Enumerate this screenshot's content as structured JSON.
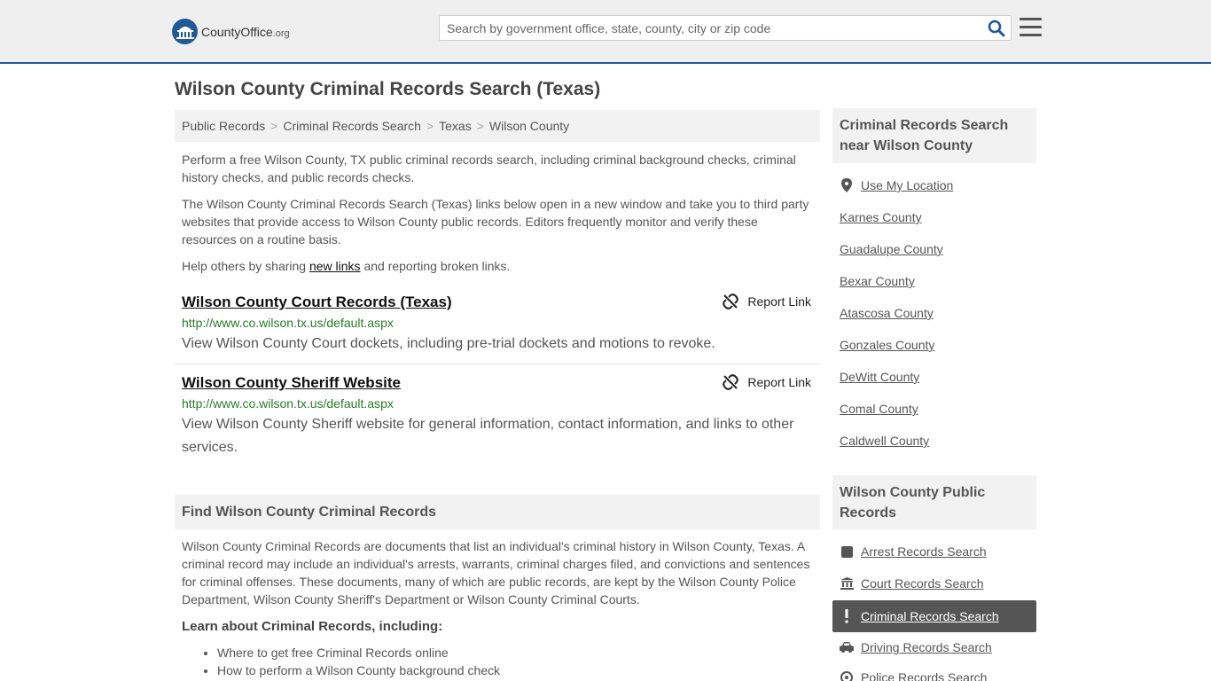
{
  "header": {
    "logo_name": "CountyOffice",
    "logo_tld": ".org",
    "search_placeholder": "Search by government office, state, county, city or zip code"
  },
  "page_title": "Wilson County Criminal Records Search (Texas)",
  "breadcrumb": [
    "Public Records",
    "Criminal Records Search",
    "Texas",
    "Wilson County"
  ],
  "intro": {
    "p1": "Perform a free Wilson County, TX public criminal records search, including criminal background checks, criminal history checks, and public records checks.",
    "p2": "The Wilson County Criminal Records Search (Texas) links below open in a new window and take you to third party websites that provide access to Wilson County public records. Editors frequently monitor and verify these resources on a routine basis.",
    "p3_before": "Help others by sharing ",
    "p3_link": "new links",
    "p3_after": " and reporting broken links."
  },
  "results": [
    {
      "title": "Wilson County Court Records (Texas)",
      "report": "Report Link",
      "url": "http://www.co.wilson.tx.us/default.aspx",
      "desc": "View Wilson County Court dockets, including pre-trial dockets and motions to revoke."
    },
    {
      "title": "Wilson County Sheriff Website",
      "report": "Report Link",
      "url": "http://www.co.wilson.tx.us/default.aspx",
      "desc": "View Wilson County Sheriff website for general information, contact information, and links to other services."
    }
  ],
  "find_section": {
    "heading": "Find Wilson County Criminal Records",
    "body": "Wilson County Criminal Records are documents that list an individual's criminal history in Wilson County, Texas. A criminal record may include an individual's arrests, warrants, criminal charges filed, and convictions and sentences for criminal offenses. These documents, many of which are public records, are kept by the Wilson County Police Department, Wilson County Sheriff's Department or Wilson County Criminal Courts.",
    "learn_heading": "Learn about Criminal Records, including:",
    "learn_items": [
      "Where to get free Criminal Records online",
      "How to perform a Wilson County background check"
    ]
  },
  "sidebar": {
    "nearby_heading": "Criminal Records Search near Wilson County",
    "use_location": "Use My Location",
    "nearby": [
      "Karnes County",
      "Guadalupe County",
      "Bexar County",
      "Atascosa County",
      "Gonzales County",
      "DeWitt County",
      "Comal County",
      "Caldwell County"
    ],
    "public_heading": "Wilson County Public Records",
    "public_links": [
      "Arrest Records Search",
      "Court Records Search",
      "Criminal Records Search",
      "Driving Records Search",
      "Police Records Search"
    ]
  },
  "colors": {
    "brand_blue": "#1f5a96",
    "url_green": "#2a7a2a",
    "active_bg": "#555555"
  }
}
